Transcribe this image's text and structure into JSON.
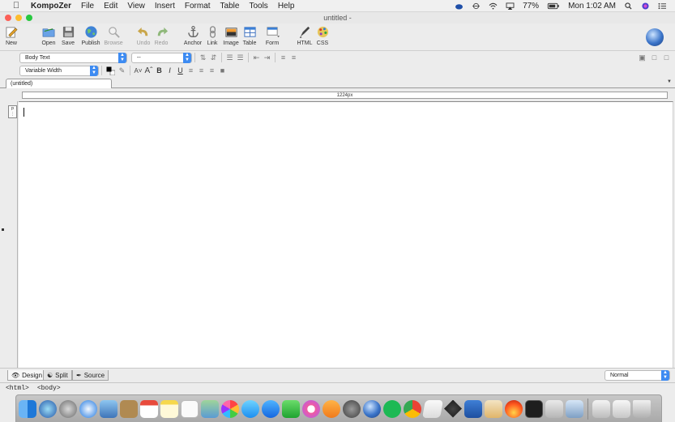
{
  "menubar": {
    "app_name": "KompoZer",
    "items": [
      "File",
      "Edit",
      "View",
      "Insert",
      "Format",
      "Table",
      "Tools",
      "Help"
    ],
    "battery": "77%",
    "clock": "Mon 1:02 AM"
  },
  "window": {
    "title": "untitled -"
  },
  "toolbar": {
    "buttons": [
      {
        "label": "New",
        "icon": "new-page-icon"
      },
      {
        "label": "Open",
        "icon": "open-folder-icon"
      },
      {
        "label": "Save",
        "icon": "floppy-icon"
      },
      {
        "label": "Publish",
        "icon": "globe-icon"
      },
      {
        "label": "Browse",
        "icon": "magnifier-icon"
      },
      {
        "label": "Undo",
        "icon": "undo-arrow-icon"
      },
      {
        "label": "Redo",
        "icon": "redo-arrow-icon"
      },
      {
        "label": "Anchor",
        "icon": "anchor-icon"
      },
      {
        "label": "Link",
        "icon": "chain-link-icon"
      },
      {
        "label": "Image",
        "icon": "image-icon"
      },
      {
        "label": "Table",
        "icon": "table-icon"
      },
      {
        "label": "Form",
        "icon": "form-icon"
      },
      {
        "label": "HTML",
        "icon": "html-pen-icon"
      },
      {
        "label": "CSS",
        "icon": "css-palette-icon"
      }
    ]
  },
  "format": {
    "paragraph_style": "Body Text",
    "class_select": "--",
    "font": "Variable Width"
  },
  "tabs": {
    "document_tab": "(untitled)"
  },
  "ruler": {
    "width_label": "1224px"
  },
  "gutter": {
    "label": "p"
  },
  "modes": {
    "design": "Design",
    "split": "Split",
    "source": "Source",
    "view_mode": "Normal"
  },
  "status": {
    "tags": [
      "<html>",
      "<body>"
    ]
  },
  "colors": {
    "accent": "#3d8bf2",
    "close": "#fc5f57",
    "minimize": "#fdbc2e",
    "zoom": "#28c840"
  }
}
